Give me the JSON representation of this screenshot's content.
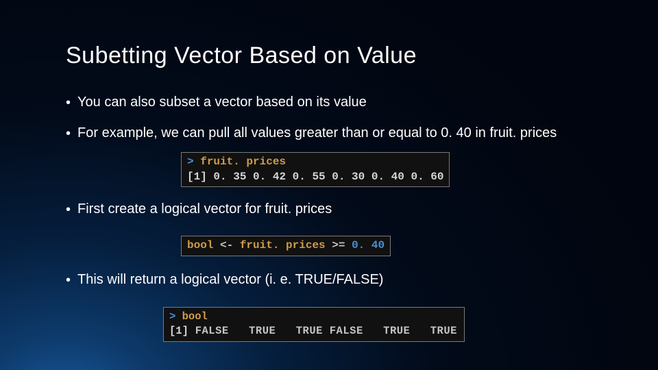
{
  "title": "Subetting Vector Based on Value",
  "bullets": {
    "b1": "You can also subset a vector based on its value",
    "b2": "For example, we can pull all values greater than or equal to 0. 40 in fruit. prices",
    "b3": "First create a logical vector for fruit. prices",
    "b4": "This will return a logical vector (i. e. TRUE/FALSE)"
  },
  "code1": {
    "prompt": ">",
    "cmd": "fruit. prices",
    "index": "[1]",
    "values": "0. 35 0. 42 0. 55 0. 30 0. 40 0. 60"
  },
  "code2": {
    "var": "bool",
    "assign": "<-",
    "expr": "fruit. prices",
    "op": ">=",
    "val": "0. 40"
  },
  "code3": {
    "prompt": ">",
    "cmd": "bool",
    "index": "[1]",
    "values": " FALSE   TRUE   TRUE FALSE   TRUE   TRUE"
  }
}
